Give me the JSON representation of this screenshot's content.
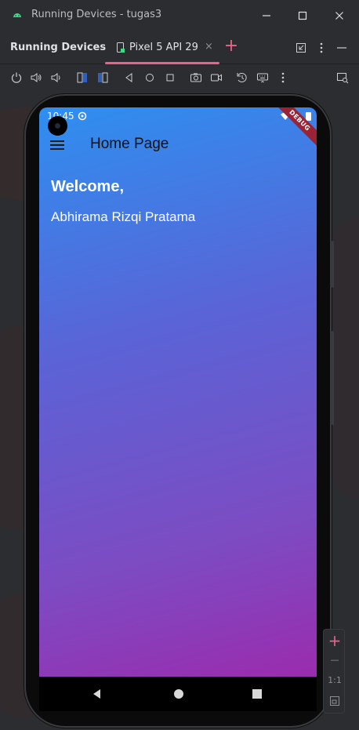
{
  "window": {
    "title": "Running Devices - tugas3",
    "app_icon": "android-icon"
  },
  "tool_window": {
    "title": "Running Devices",
    "device_tab": {
      "label": "Pixel 5 API 29",
      "close": "×"
    },
    "add_tab": "+"
  },
  "toolbar": {
    "icons": [
      "power-icon",
      "volume-up-icon",
      "volume-down-icon",
      "rotate-left-icon",
      "rotate-right-icon",
      "back-icon",
      "home-icon",
      "overview-icon",
      "screenshot-icon",
      "screen-record-icon",
      "reset-icon",
      "keyboard-icon",
      "more-icon",
      "zoom-to-fit-icon"
    ]
  },
  "device": {
    "status_time": "10:45",
    "debug_banner": "DEBUG",
    "app": {
      "appbar_title": "Home Page",
      "welcome_text": "Welcome,",
      "user_name": "Abhirama Rizqi Pratama"
    }
  },
  "zoom": {
    "plus": "+",
    "minus": "—",
    "ratio": "1:1"
  },
  "colors": {
    "accent": "#e7648a",
    "gradient_top": "#2e8ff0",
    "gradient_bottom": "#9a2cae",
    "ide_background": "#2b2d30"
  }
}
